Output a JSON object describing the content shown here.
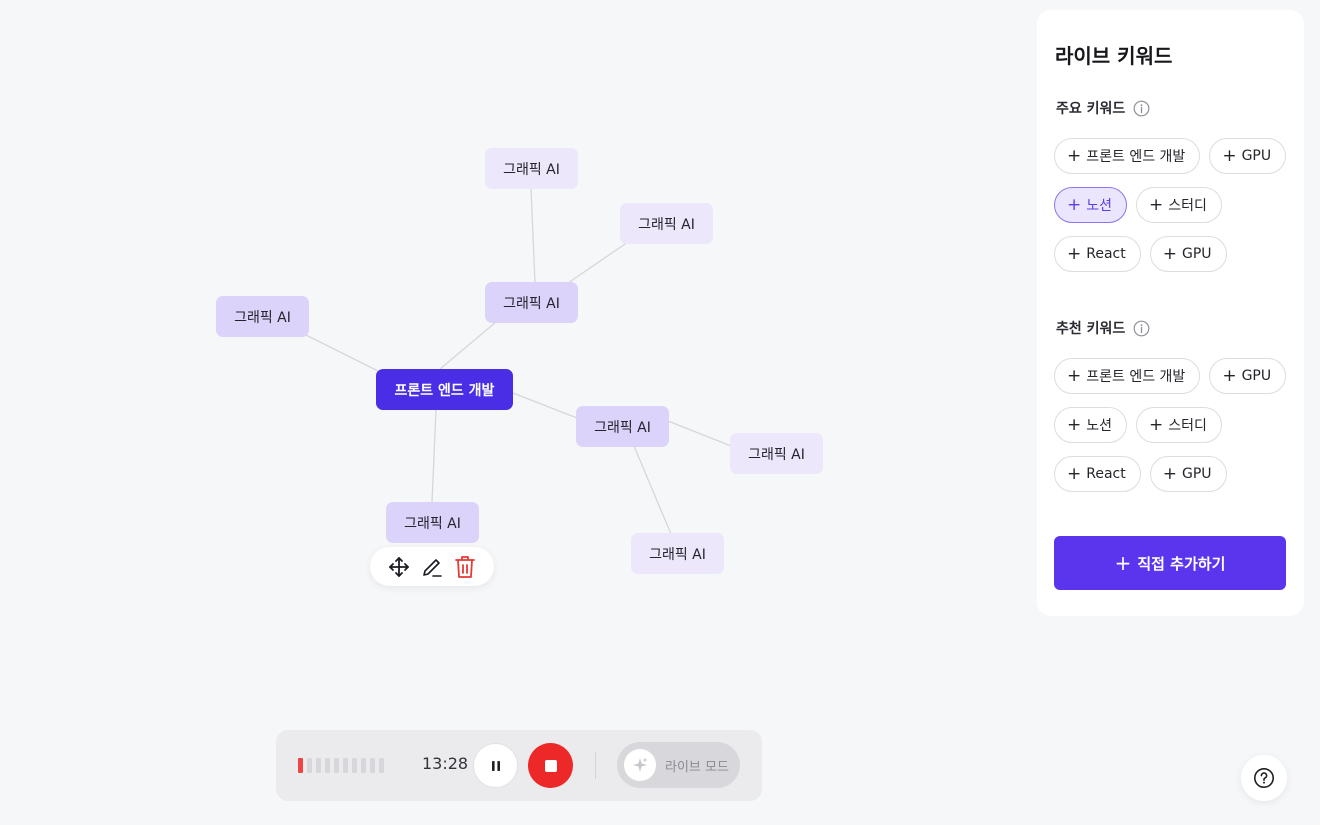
{
  "colors": {
    "accent": "#5b35ee",
    "root_node": "#4a2ee6",
    "node": "#dcd3fa",
    "node_light": "#ece7fb",
    "stop": "#ec2828",
    "delete": "#e53935"
  },
  "mindmap": {
    "root": {
      "label": "프론트 엔드 개발"
    },
    "nodes": [
      {
        "id": "top",
        "label": "그래픽 AI"
      },
      {
        "id": "top-right",
        "label": "그래픽 AI"
      },
      {
        "id": "mid-upper",
        "label": "그래픽 AI"
      },
      {
        "id": "left",
        "label": "그래픽 AI"
      },
      {
        "id": "mid-right",
        "label": "그래픽 AI"
      },
      {
        "id": "far-right",
        "label": "그래픽 AI"
      },
      {
        "id": "bottom-left",
        "label": "그래픽 AI"
      },
      {
        "id": "bottom-right",
        "label": "그래픽 AI"
      }
    ],
    "toolbar": {
      "icons": [
        "move-icon",
        "edit-icon",
        "delete-icon"
      ]
    }
  },
  "panel": {
    "title": "라이브 키워드",
    "main_keywords": {
      "title": "주요 키워드",
      "chips": [
        {
          "label": "프론트 엔드 개발",
          "active": false
        },
        {
          "label": "GPU",
          "active": false
        },
        {
          "label": "노션",
          "active": true
        },
        {
          "label": "스터디",
          "active": false
        },
        {
          "label": "React",
          "active": false
        },
        {
          "label": "GPU",
          "active": false
        }
      ]
    },
    "recommended_keywords": {
      "title": "추천 키워드",
      "chips": [
        {
          "label": "프론트 엔드 개발",
          "active": false
        },
        {
          "label": "GPU",
          "active": false
        },
        {
          "label": "노션",
          "active": false
        },
        {
          "label": "스터디",
          "active": false
        },
        {
          "label": "React",
          "active": false
        },
        {
          "label": "GPU",
          "active": false
        }
      ]
    },
    "add_button": "직접 추가하기"
  },
  "recorder": {
    "level": 0.1,
    "timer": "13:28",
    "live_mode_label": "라이브 모드",
    "live_mode_on": false
  }
}
